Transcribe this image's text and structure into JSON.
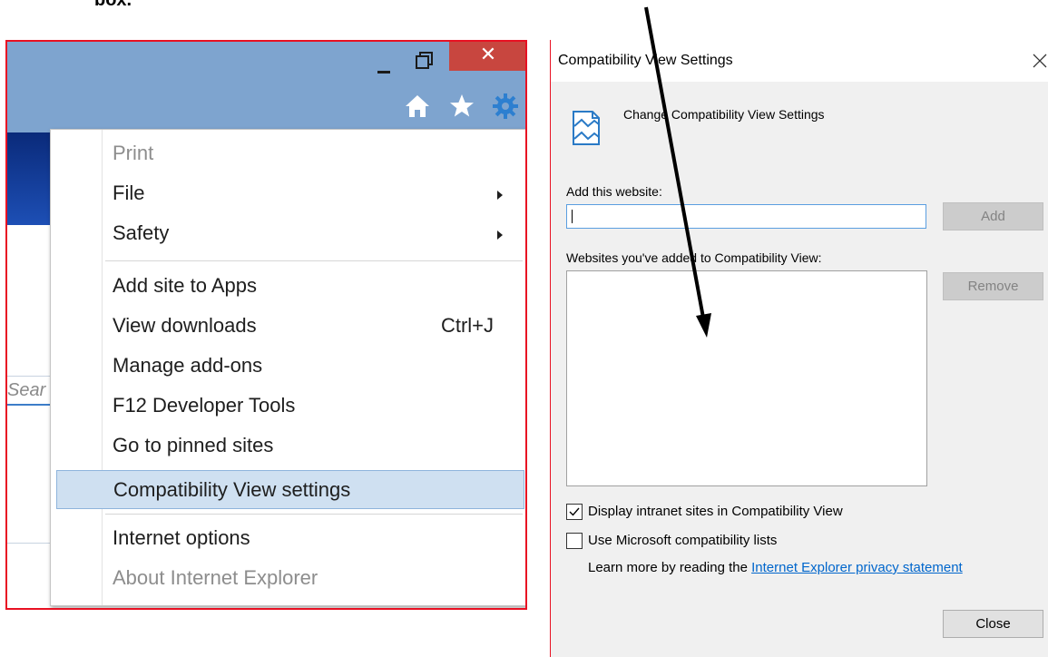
{
  "caption": {
    "partial_text": "box."
  },
  "ie_window": {
    "titlebar": {
      "minimize_icon": "minimize-icon",
      "restore_icon": "restore-icon",
      "close_symbol": "✕"
    },
    "toolbar_icons": [
      "home-icon",
      "star-icon",
      "gear-icon"
    ],
    "search_stub_text": "Sear",
    "menu": {
      "items": [
        {
          "label": "Print",
          "disabled": true
        },
        {
          "label": "File",
          "submenu": true
        },
        {
          "label": "Safety",
          "submenu": true
        },
        {
          "label": "Add site to Apps"
        },
        {
          "label": "View downloads",
          "shortcut": "Ctrl+J"
        },
        {
          "label": "Manage add-ons"
        },
        {
          "label": "F12 Developer Tools"
        },
        {
          "label": "Go to pinned sites"
        },
        {
          "label": "Compatibility View settings",
          "highlighted": true
        },
        {
          "label": "Internet options"
        },
        {
          "label": "About Internet Explorer",
          "disabled": true
        }
      ]
    }
  },
  "compat_dialog": {
    "title": "Compatibility View Settings",
    "heading": "Change Compatibility View Settings",
    "add_label": "Add this website:",
    "add_input_value": "",
    "add_button": "Add",
    "list_label": "Websites you've added to Compatibility View:",
    "list_items": [],
    "remove_button": "Remove",
    "checkbox_intranet": {
      "label": "Display intranet sites in Compatibility View",
      "checked": true
    },
    "checkbox_ms_lists": {
      "label": "Use Microsoft compatibility lists",
      "checked": false
    },
    "learn_more_prefix": "Learn more by reading the ",
    "learn_more_link": "Internet Explorer privacy statement",
    "close_button": "Close"
  },
  "colors": {
    "panel_border": "#e81123",
    "ie_titlebar": "#7ea4cf",
    "ie_close": "#c8463f",
    "menu_highlight": "#cfe0f1",
    "gear": "#2d7fd0",
    "link": "#0066cc",
    "dialog_body": "#f0f0f0"
  }
}
